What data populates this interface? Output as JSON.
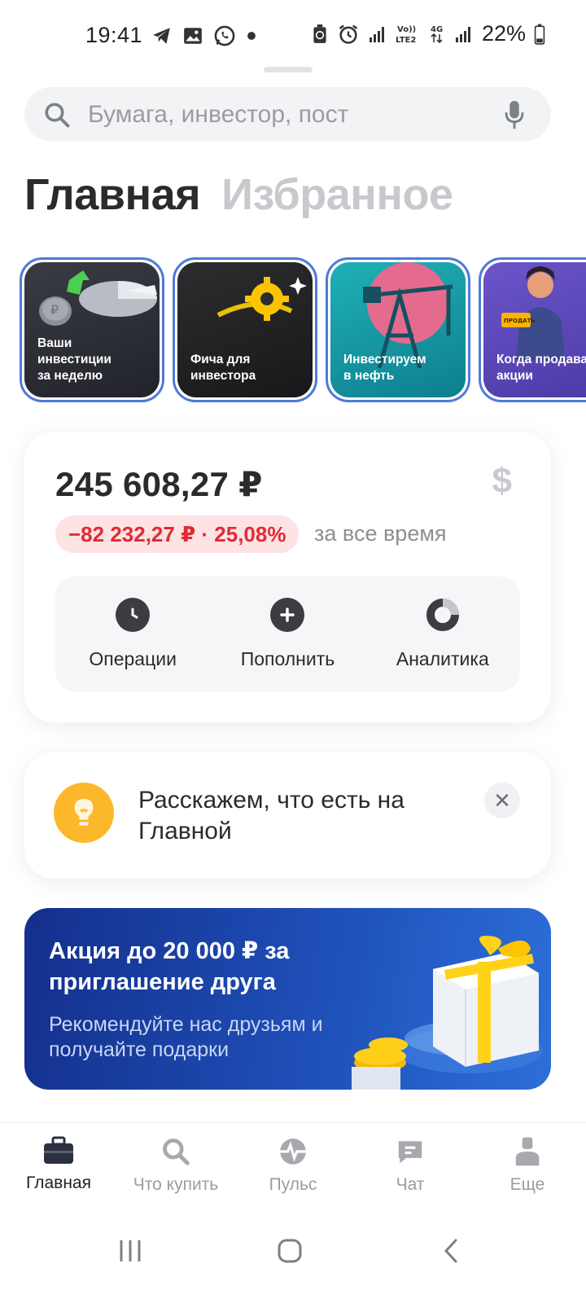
{
  "status_bar": {
    "time": "19:41",
    "battery": "22%",
    "left_icons": [
      "telegram-icon",
      "gallery-icon",
      "whatsapp-icon",
      "dot-icon"
    ],
    "right_icons": [
      "recycle-battery-icon",
      "alarm-icon",
      "signal-icon",
      "volte-icon",
      "4g-icon",
      "signal-icon",
      "battery-icon"
    ],
    "volte_text": "Vo)) LTE2",
    "net_text": "4G"
  },
  "search": {
    "placeholder": "Бумага, инвестор, пост"
  },
  "tabs": [
    {
      "label": "Главная",
      "active": true
    },
    {
      "label": "Избранное",
      "active": false
    }
  ],
  "stories": [
    {
      "label": "Ваши\nинвестиции\nза неделю"
    },
    {
      "label": "Фича для\nинвестора"
    },
    {
      "label": "Инвестируем\nв нефть"
    },
    {
      "label": "Когда продавать\nакции",
      "badge": "ПРОДАТЬ"
    }
  ],
  "portfolio": {
    "total": "245 608,27 ₽",
    "currency_symbol": "$",
    "change": "−82 232,27 ₽ · 25,08%",
    "period": "за все время",
    "actions": [
      {
        "label": "Операции",
        "icon": "clock-icon"
      },
      {
        "label": "Пополнить",
        "icon": "plus-icon"
      },
      {
        "label": "Аналитика",
        "icon": "donut-chart-icon"
      }
    ]
  },
  "hint": {
    "text": "Расскажем, что есть на Главной",
    "close": "✕"
  },
  "promo": {
    "title": "Акция до 20 000 ₽ за приглашение друга",
    "subtitle": "Рекомендуйте нас друзьям и получайте подарки"
  },
  "bottom_nav": [
    {
      "label": "Главная",
      "icon": "briefcase-icon",
      "active": true
    },
    {
      "label": "Что купить",
      "icon": "search-icon",
      "active": false
    },
    {
      "label": "Пульс",
      "icon": "pulse-icon",
      "active": false
    },
    {
      "label": "Чат",
      "icon": "chat-icon",
      "active": false
    },
    {
      "label": "Еще",
      "icon": "profile-icon",
      "active": false
    }
  ],
  "colors": {
    "accent_red": "#e02b35",
    "badge_red_bg": "#fde3e4",
    "promo_blue": "#1e4fb7",
    "bulb_yellow": "#fcb82a"
  }
}
